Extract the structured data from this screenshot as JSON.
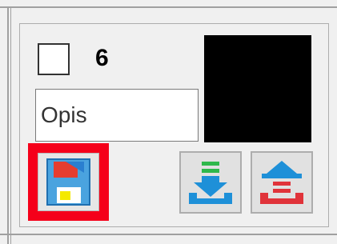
{
  "row": {
    "checkbox_checked": false,
    "number": "6",
    "description": {
      "value": "Opis",
      "placeholder": ""
    },
    "preview_color": "#000000"
  },
  "buttons": {
    "save": {
      "icon": "save-floppy-icon",
      "highlighted": true,
      "highlight_color": "#f5001a"
    },
    "move_down": {
      "icon": "move-down-icon"
    },
    "move_up": {
      "icon": "move-up-icon"
    }
  }
}
